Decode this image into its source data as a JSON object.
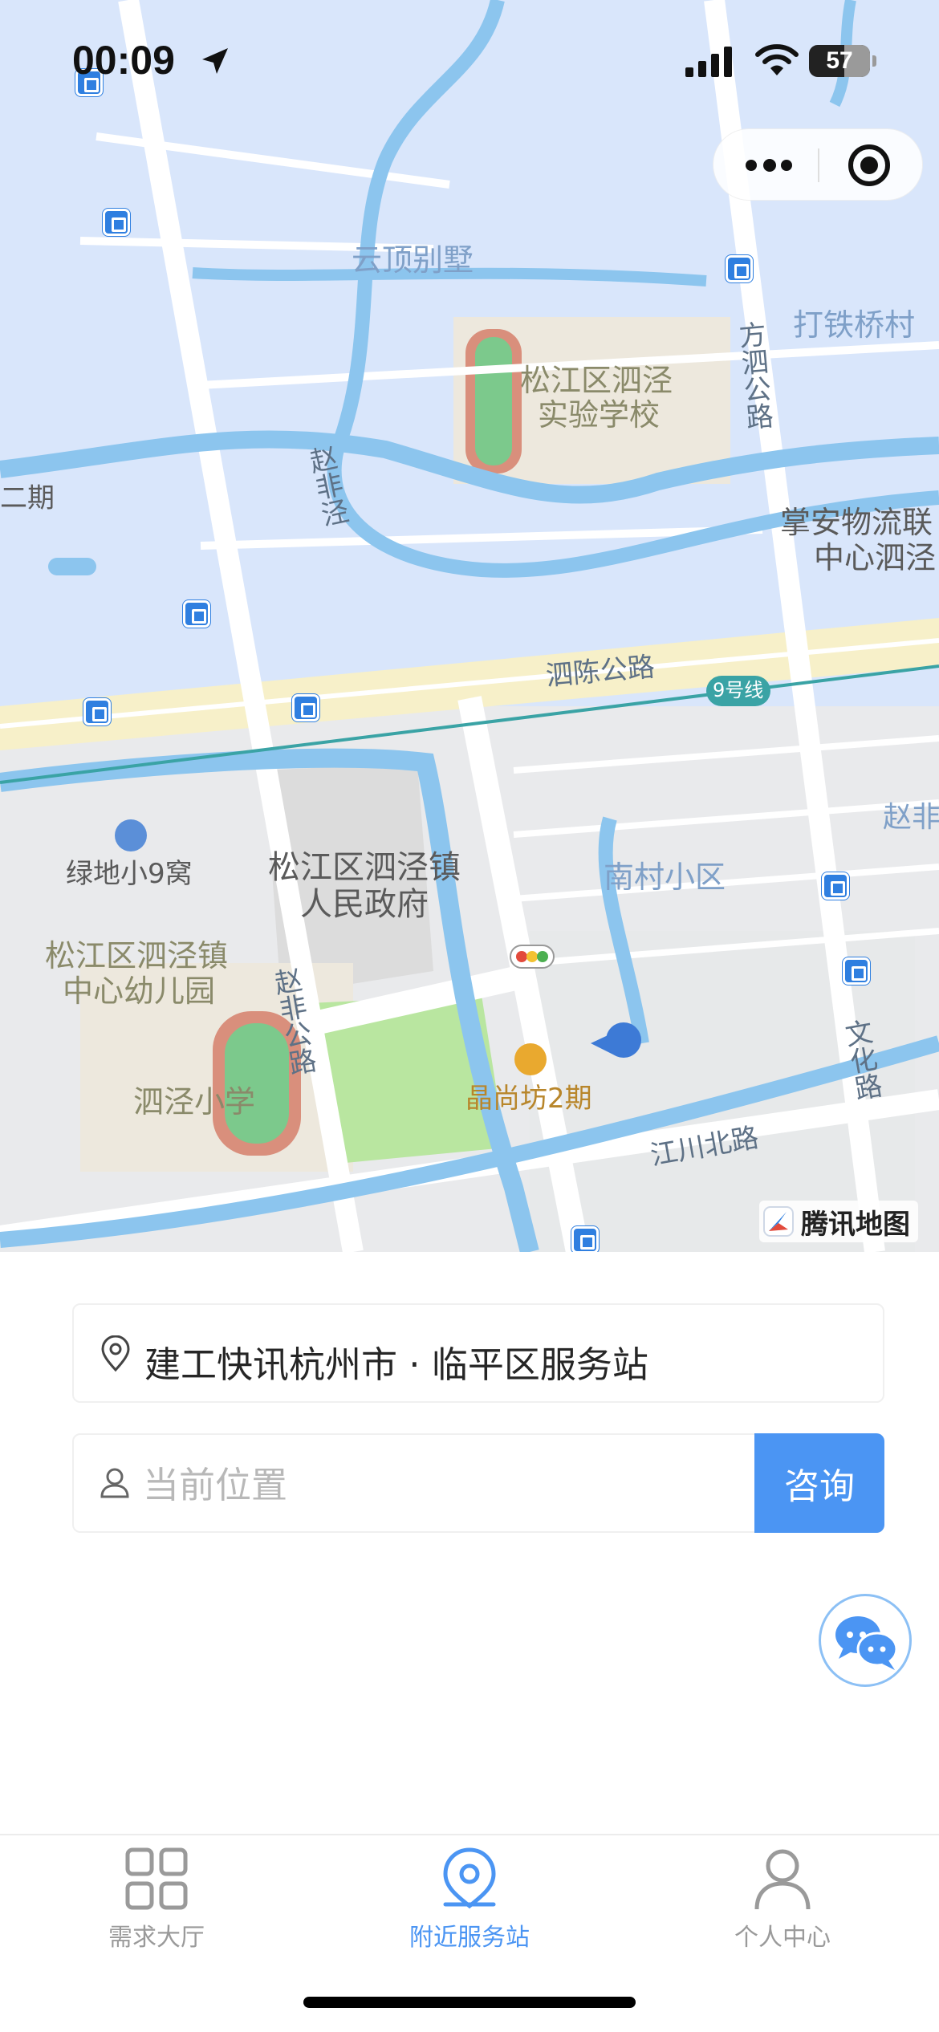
{
  "status_bar": {
    "time": "00:09",
    "battery": "57"
  },
  "map": {
    "labels": {
      "villa": "云顶别墅",
      "school_1": "松江区泗泾",
      "school_2": "实验学校",
      "datiqiao": "打铁桥村",
      "fangsi_road": "方泗公路",
      "erqi": "二期",
      "zhaofeijing": "赵非泾",
      "logistics_1": "掌安物流联",
      "logistics_2": "中心泗泾",
      "sichen_road": "泗陈公路",
      "metro_line": "9号线",
      "zhaofei_right": "赵非",
      "lvdi": "绿地小9窝",
      "gov_1": "松江区泗泾镇",
      "gov_2": "人民政府",
      "nancun": "南村小区",
      "kinder_1": "松江区泗泾镇",
      "kinder_2": "中心幼儿园",
      "zhaofei_road": "赵非公路",
      "wenhua_road": "文化路",
      "sijing_primary": "泗泾小学",
      "jingshangfang": "晶尚坊2期",
      "jiangchuan_road": "江川北路"
    },
    "provider": "腾讯地图"
  },
  "station": {
    "name": "建工快讯杭州市 · 临平区服务站"
  },
  "location_input": {
    "placeholder": "当前位置",
    "value": ""
  },
  "consult_button": {
    "label": "咨询"
  },
  "tabbar": {
    "tabs": [
      {
        "label": "需求大厅",
        "icon": "grid-icon",
        "active": false
      },
      {
        "label": "附近服务站",
        "icon": "location-pin-icon",
        "active": true
      },
      {
        "label": "个人中心",
        "icon": "person-icon",
        "active": false
      }
    ]
  },
  "colors": {
    "accent": "#4b95f3",
    "map_water": "#8cc5ee",
    "map_land": "#d9e6fb",
    "tab_inactive": "#9a9a9a"
  }
}
